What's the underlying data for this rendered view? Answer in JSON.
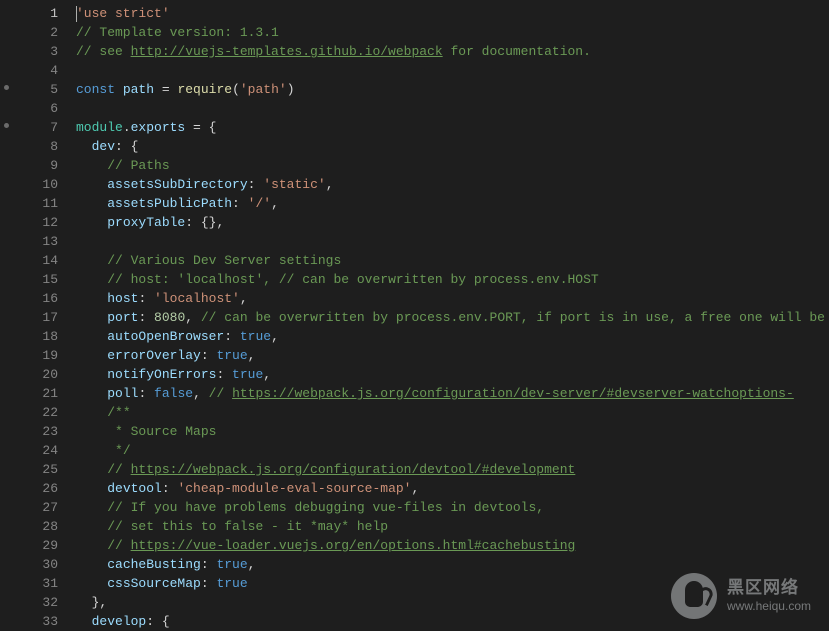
{
  "line_numbers": [
    "1",
    "2",
    "3",
    "4",
    "5",
    "6",
    "7",
    "8",
    "9",
    "10",
    "11",
    "12",
    "13",
    "14",
    "15",
    "16",
    "17",
    "18",
    "19",
    "20",
    "21",
    "22",
    "23",
    "24",
    "25",
    "26",
    "27",
    "28",
    "29",
    "30",
    "31",
    "32",
    "33"
  ],
  "code": {
    "l1": {
      "str": "'use strict'"
    },
    "l2": {
      "c": "// Template version: 1.3.1"
    },
    "l3": {
      "c1": "// see ",
      "link": "http://vuejs-templates.github.io/webpack",
      "c2": " for documentation."
    },
    "l5": {
      "kw": "const",
      "sp": " ",
      "var": "path",
      "eq": " = ",
      "fn": "require",
      "p1": "(",
      "str": "'path'",
      "p2": ")"
    },
    "l7": {
      "obj": "module",
      "dot": ".",
      "prop": "exports",
      "eq": " = {"
    },
    "l8": {
      "prop": "dev",
      "p": ": {"
    },
    "l9": {
      "c": "// Paths"
    },
    "l10": {
      "prop": "assetsSubDirectory",
      "p": ": ",
      "str": "'static'",
      "e": ","
    },
    "l11": {
      "prop": "assetsPublicPath",
      "p": ": ",
      "str": "'/'",
      "e": ","
    },
    "l12": {
      "prop": "proxyTable",
      "p": ": {},"
    },
    "l14": {
      "c": "// Various Dev Server settings"
    },
    "l15": {
      "c": "// host: 'localhost', // can be overwritten by process.env.HOST"
    },
    "l16": {
      "prop": "host",
      "p": ": ",
      "str": "'localhost'",
      "e": ","
    },
    "l17": {
      "prop": "port",
      "p": ": ",
      "num": "8080",
      "e": ", ",
      "c": "// can be overwritten by process.env.PORT, if port is in use, a free one will be d"
    },
    "l18": {
      "prop": "autoOpenBrowser",
      "p": ": ",
      "bool": "true",
      "e": ","
    },
    "l19": {
      "prop": "errorOverlay",
      "p": ": ",
      "bool": "true",
      "e": ","
    },
    "l20": {
      "prop": "notifyOnErrors",
      "p": ": ",
      "bool": "true",
      "e": ","
    },
    "l21": {
      "prop": "poll",
      "p": ": ",
      "bool": "false",
      "e": ", ",
      "c": "// ",
      "link": "https://webpack.js.org/configuration/dev-server/#devserver-watchoptions-"
    },
    "l22": {
      "c": "/**"
    },
    "l23": {
      "c": " * Source Maps"
    },
    "l24": {
      "c": " */"
    },
    "l25": {
      "c": "// ",
      "link": "https://webpack.js.org/configuration/devtool/#development"
    },
    "l26": {
      "prop": "devtool",
      "p": ": ",
      "str": "'cheap-module-eval-source-map'",
      "e": ","
    },
    "l27": {
      "c": "// If you have problems debugging vue-files in devtools,"
    },
    "l28": {
      "c": "// set this to false - it *may* help"
    },
    "l29": {
      "c": "// ",
      "link": "https://vue-loader.vuejs.org/en/options.html#cachebusting"
    },
    "l30": {
      "prop": "cacheBusting",
      "p": ": ",
      "bool": "true",
      "e": ","
    },
    "l31": {
      "prop": "cssSourceMap",
      "p": ": ",
      "bool": "true"
    },
    "l32": {
      "p": "},"
    },
    "l33": {
      "prop": "develop",
      "p": ": {"
    }
  },
  "watermark": {
    "top": "黑区网络",
    "bottom": "www.heiqu.com"
  }
}
